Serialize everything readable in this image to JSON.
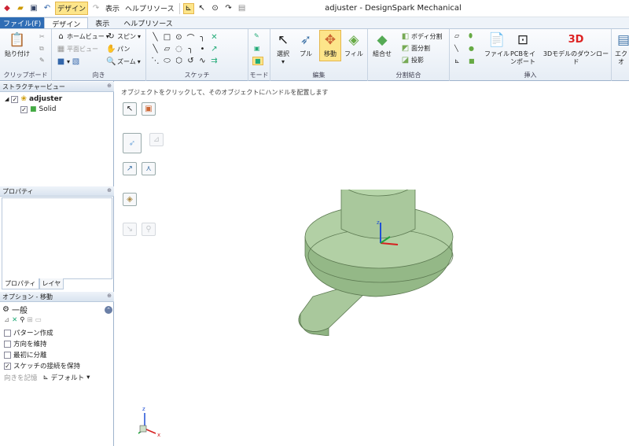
{
  "window": {
    "title": "adjuster - DesignSpark Mechanical"
  },
  "qat": {
    "mode_label": "デザイン",
    "view_label": "表示",
    "help_label": "ヘルプリソース"
  },
  "tabs": {
    "file": "ファイル(F)",
    "design": "デザイン",
    "view": "表示",
    "help": "ヘルプリソース"
  },
  "ribbon": {
    "clipboard": {
      "paste": "貼り付け",
      "label": "クリップボード"
    },
    "orient": {
      "home": "ホームビュー",
      "plan": "平面ビュー",
      "spin": "スピン",
      "pan": "パン",
      "zoom": "ズーム",
      "label": "向き"
    },
    "sketch": {
      "label": "スケッチ"
    },
    "mode": {
      "label": "モード"
    },
    "edit": {
      "select": "選択",
      "pull": "プル",
      "move": "移動",
      "fill": "フィル",
      "label": "編集"
    },
    "intersect": {
      "combine": "組合せ",
      "split_body": "ボディ分割",
      "split_face": "面分割",
      "project": "投影",
      "label": "分割結合"
    },
    "insert": {
      "file": "ファイル",
      "pcb": "PCBをインポート",
      "download": "3Dモデルのダウンロード",
      "label": "挿入",
      "export_partial": "エク\nオ"
    }
  },
  "structure": {
    "header": "ストラクチャービュー",
    "root": "adjuster",
    "child": "Solid"
  },
  "properties": {
    "header": "プロパティ",
    "tab_props": "プロパティ",
    "tab_layers": "レイヤ"
  },
  "options": {
    "header": "オプション - 移動",
    "section": "一般",
    "pattern": "パターン作成",
    "keep_orient": "方向を維持",
    "detach_first": "最初に分離",
    "maintain_sketch": "スケッチの接続を保持",
    "ruler_label": "向きを記憶",
    "default_label": "デフォルト"
  },
  "canvas": {
    "hint": "オブジェクトをクリックして、そのオブジェクトにハンドルを配置します"
  },
  "axis_labels": {
    "x": "x",
    "y": "y",
    "z": "z"
  },
  "colors": {
    "model": "#a9c89c",
    "model_edge": "#5d7a52",
    "accent": "#fde58a"
  }
}
